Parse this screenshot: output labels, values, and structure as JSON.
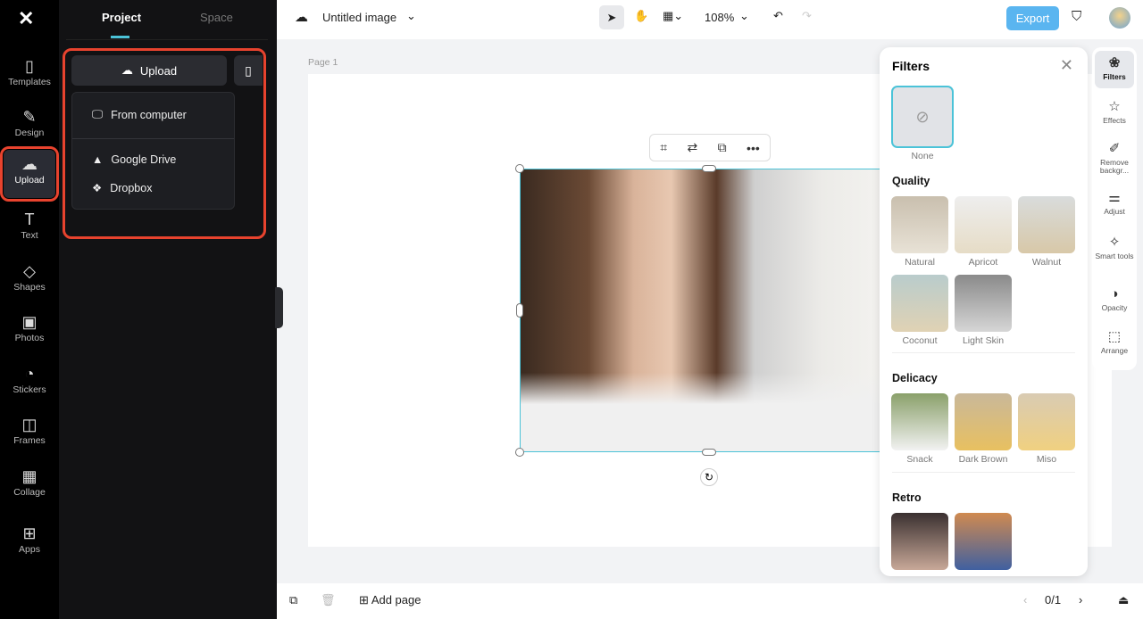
{
  "rail": {
    "items": [
      {
        "label": "Templates",
        "icon": "▯"
      },
      {
        "label": "Design",
        "icon": "✎"
      },
      {
        "label": "Upload",
        "icon": "☁"
      },
      {
        "label": "Text",
        "icon": "T"
      },
      {
        "label": "Shapes",
        "icon": "◇"
      },
      {
        "label": "Photos",
        "icon": "▣"
      },
      {
        "label": "Stickers",
        "icon": "◔"
      },
      {
        "label": "Frames",
        "icon": "◫"
      },
      {
        "label": "Collage",
        "icon": "▦"
      },
      {
        "label": "Apps",
        "icon": "⊞"
      }
    ]
  },
  "panel": {
    "tabs": [
      "Project",
      "Space"
    ],
    "upload_label": "Upload",
    "menu": [
      "From computer",
      "Google Drive",
      "Dropbox"
    ]
  },
  "topbar": {
    "title": "Untitled image",
    "zoom": "108%",
    "export": "Export"
  },
  "canvas": {
    "page_label": "Page 1"
  },
  "filters": {
    "title": "Filters",
    "none": "None",
    "sections": [
      {
        "title": "Quality",
        "items": [
          "Natural",
          "Apricot",
          "Walnut",
          "Coconut",
          "Light Skin"
        ]
      },
      {
        "title": "Delicacy",
        "items": [
          "Snack",
          "Dark Brown",
          "Miso"
        ]
      },
      {
        "title": "Retro",
        "items": [
          "",
          ""
        ]
      }
    ]
  },
  "tools": [
    {
      "label": "Filters",
      "icon": "❀"
    },
    {
      "label": "Effects",
      "icon": "☆"
    },
    {
      "label": "Remove backgr...",
      "icon": "✐"
    },
    {
      "label": "Adjust",
      "icon": "⚌"
    },
    {
      "label": "Smart tools",
      "icon": "✧"
    },
    {
      "label": "Opacity",
      "icon": "◑"
    },
    {
      "label": "Arrange",
      "icon": "⬚"
    }
  ],
  "bottom": {
    "add_page": "Add page",
    "page_count": "0/1"
  }
}
